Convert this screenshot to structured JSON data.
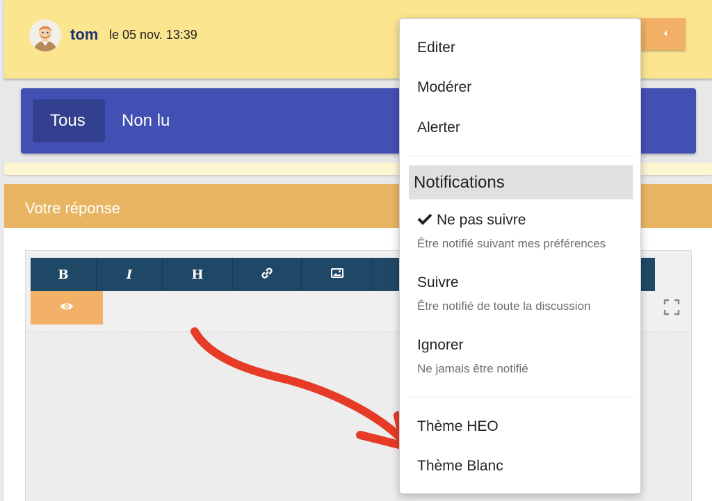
{
  "post": {
    "author": "tom",
    "date": "le 05 nov. 13:39",
    "avatar_icon": "user-avatar-icon",
    "caret_icon": "caret-left-icon"
  },
  "filters": {
    "tabs": [
      {
        "label": "Tous",
        "active": true
      },
      {
        "label": "Non lu",
        "active": false
      }
    ]
  },
  "reply": {
    "title": "Votre réponse",
    "toolbar": [
      "B",
      "I",
      "H",
      "link-icon",
      "image-icon",
      ""
    ],
    "preview_icon": "eye-icon",
    "fullscreen_icon": "fullscreen-icon"
  },
  "menu": {
    "items": [
      "Editer",
      "Modérer",
      "Alerter"
    ],
    "notifications_header": "Notifications",
    "notification_options": [
      {
        "label": "Ne pas suivre",
        "description": "Être notifié suivant mes préférences",
        "checked": true
      },
      {
        "label": "Suivre",
        "description": "Être notifié de toute la discussion",
        "checked": false
      },
      {
        "label": "Ignorer",
        "description": "Ne jamais être notifié",
        "checked": false
      }
    ],
    "themes": [
      "Thème HEO",
      "Thème Blanc"
    ]
  },
  "colors": {
    "header_bg": "#fbe58f",
    "filter_bar": "#4350b3",
    "reply_bar": "#e8b562",
    "toolbar": "#1f4866",
    "accent_orange": "#f3b167",
    "annotation_arrow": "#e63b26"
  }
}
